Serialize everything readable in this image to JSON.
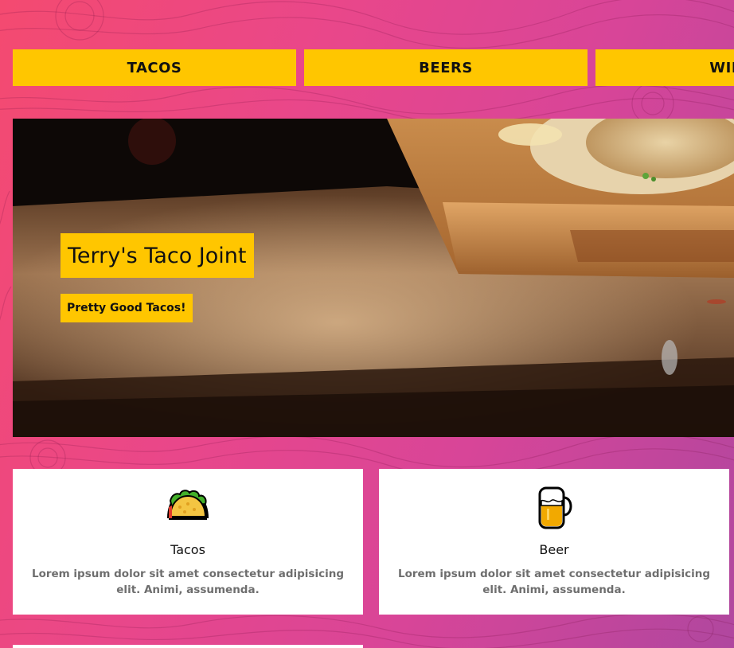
{
  "nav": {
    "items": [
      {
        "label": "TACOS"
      },
      {
        "label": "BEERS"
      },
      {
        "label": "WINES"
      }
    ]
  },
  "hero": {
    "title": "Terry's Taco Joint",
    "subtitle": "Pretty Good Tacos!"
  },
  "features": [
    {
      "icon": "taco-icon",
      "title": "Tacos",
      "text": "Lorem ipsum dolor sit amet consectetur adipisicing elit. Animi, assumenda."
    },
    {
      "icon": "beer-mug-icon",
      "title": "Beer",
      "text": "Lorem ipsum dolor sit amet consectetur adipisicing elit. Animi, assumenda."
    }
  ],
  "colors": {
    "accent": "#ffc600",
    "gradient_start": "#f44a70",
    "gradient_end": "#b0479f",
    "card_bg": "#ffffff",
    "muted_text": "#6e6e6e"
  }
}
